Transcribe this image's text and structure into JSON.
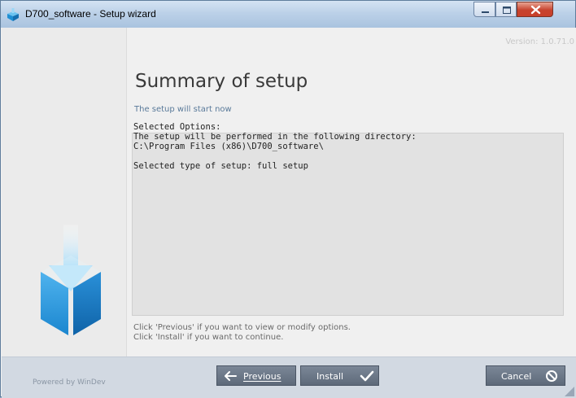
{
  "window": {
    "title": "D700_software - Setup wizard"
  },
  "header": {
    "version": "Version: 1.0.71.0"
  },
  "main": {
    "heading": "Summary of setup",
    "subtitle": "The setup will start now",
    "summary_lines": "Selected Options:\nThe setup will be performed in the following directory:\nC:\\Program Files (x86)\\D700_software\\\n\nSelected type of setup: full setup",
    "hint": "Click 'Previous' if you want to view or modify options.\nClick 'Install' if you want to continue."
  },
  "footer": {
    "powered_by": "Powered by WinDev",
    "previous_label": "Previous",
    "install_label": "Install",
    "cancel_label": "Cancel"
  },
  "icons": {
    "app": "setup-box-icon",
    "sidebar": "download-box-icon",
    "previous": "arrow-left-icon",
    "install": "checkmark-icon",
    "cancel": "cancel-circle-icon"
  },
  "colors": {
    "brand_blue": "#2a8fd6",
    "footer_bg": "#d2d9e2",
    "button_bg": "#6b7787"
  }
}
